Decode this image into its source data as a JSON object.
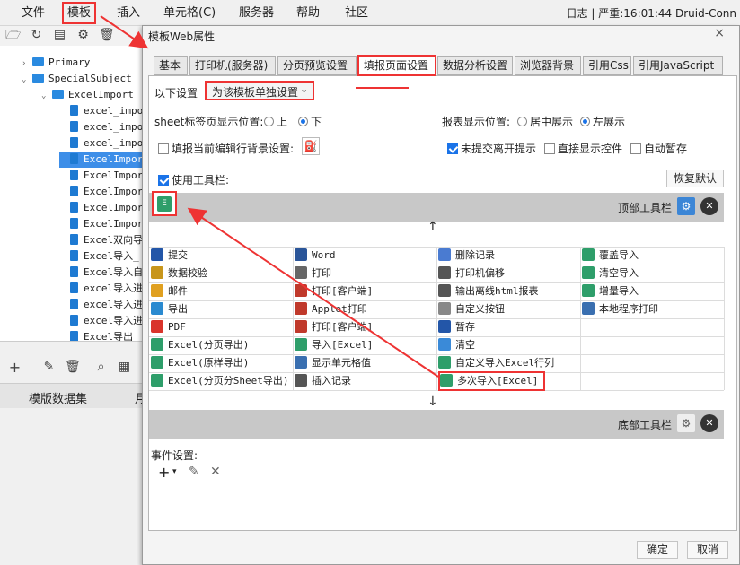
{
  "menu": {
    "items": [
      "文件",
      "模板",
      "插入",
      "单元格(C)",
      "服务器",
      "帮助",
      "社区"
    ],
    "status": "日志 | 严重:16:01:44 Druid-Conn"
  },
  "tree": {
    "items": [
      {
        "label": "Primary",
        "type": "folder"
      },
      {
        "label": "SpecialSubject",
        "type": "folder"
      },
      {
        "label": "ExcelImport",
        "type": "folder"
      },
      {
        "label": "excel_impo",
        "type": "file"
      },
      {
        "label": "excel_impo",
        "type": "file"
      },
      {
        "label": "excel_impo",
        "type": "file"
      },
      {
        "label": "ExcelImpor",
        "type": "file",
        "selected": true
      },
      {
        "label": "ExcelImpor",
        "type": "file"
      },
      {
        "label": "ExcelImpor",
        "type": "file"
      },
      {
        "label": "ExcelImpor",
        "type": "file"
      },
      {
        "label": "ExcelImpor",
        "type": "file"
      },
      {
        "label": "Excel双向导",
        "type": "file"
      },
      {
        "label": "Excel导入_",
        "type": "file"
      },
      {
        "label": "Excel导入自",
        "type": "file"
      },
      {
        "label": "excel导入进",
        "type": "file"
      },
      {
        "label": "excel导入进",
        "type": "file"
      },
      {
        "label": "excel导入进",
        "type": "file"
      },
      {
        "label": "Excel导出_",
        "type": "file"
      }
    ],
    "bottom_tab": "模版数据集",
    "bottom_tab2": "月"
  },
  "dialog": {
    "title": "模板Web属性",
    "tabs": [
      "基本",
      "打印机(服务器)",
      "分页预览设置",
      "填报页面设置",
      "数据分析设置",
      "浏览器背景",
      "引用Css",
      "引用JavaScript"
    ],
    "active_tab": "填报页面设置",
    "setting_label": "以下设置",
    "setting_value": "为该模板单独设置",
    "sheet_pos_label": "sheet标签页显示位置:",
    "sheet_pos_top": "上",
    "sheet_pos_bottom": "下",
    "report_pos_label": "报表显示位置:",
    "report_pos_center": "居中展示",
    "report_pos_left": "左展示",
    "fill_bg_label": "填报当前编辑行背景设置:",
    "unsubmitted_label": "未提交离开提示",
    "direct_ctrl_label": "直接显示控件",
    "autosave_label": "自动暂存",
    "use_toolbar_label": "使用工具栏:",
    "restore_default": "恢复默认",
    "top_toolbar": "顶部工具栏",
    "bottom_toolbar": "底部工具栏",
    "event_label": "事件设置:",
    "ok": "确定",
    "cancel": "取消",
    "buttons": [
      [
        "提交",
        "Word",
        "删除记录",
        "覆盖导入"
      ],
      [
        "数据校验",
        "打印",
        "打印机偏移",
        "清空导入"
      ],
      [
        "邮件",
        "打印[客户端]",
        "输出离线html报表",
        "增量导入"
      ],
      [
        "导出",
        "Applet打印",
        "自定义按钮",
        "本地程序打印"
      ],
      [
        "PDF",
        "打印[客户端]",
        "暂存",
        ""
      ],
      [
        "Excel(分页导出)",
        "导入[Excel]",
        "清空",
        ""
      ],
      [
        "Excel(原样导出)",
        "显示单元格值",
        "自定义导入Excel行列",
        ""
      ],
      [
        "Excel(分页分Sheet导出)",
        "插入记录",
        "多次导入[Excel]",
        ""
      ]
    ]
  }
}
